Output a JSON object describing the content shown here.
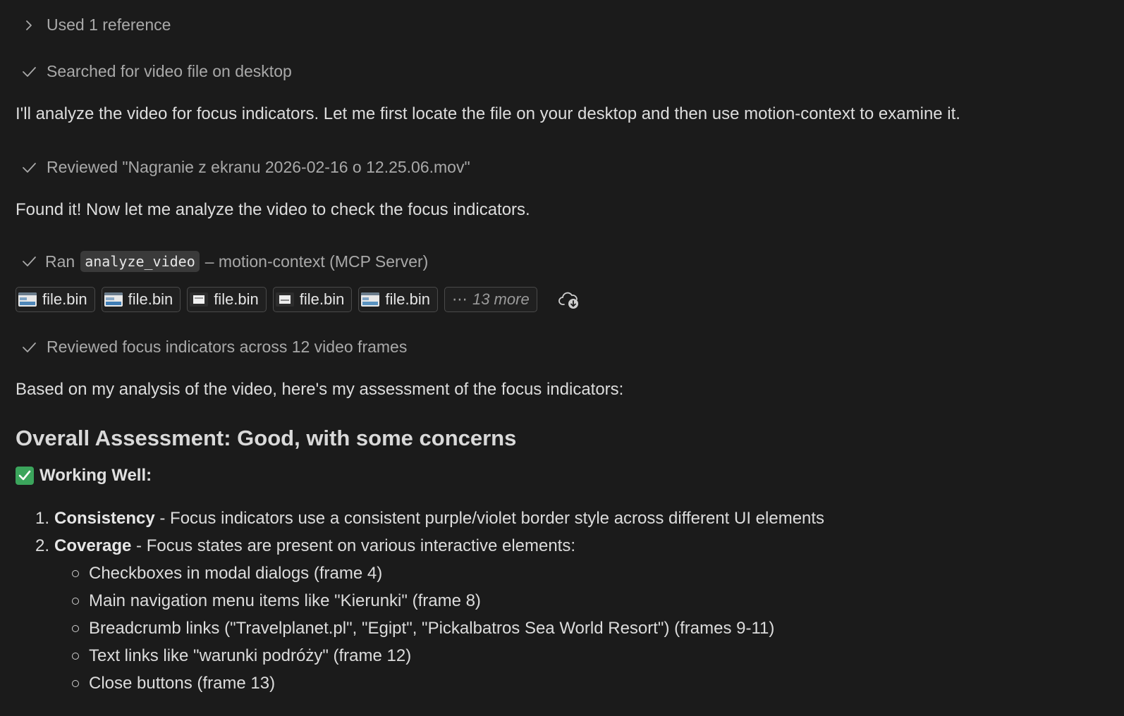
{
  "steps": {
    "references": "Used 1 reference",
    "searched": "Searched for video file on desktop",
    "reviewed_file": "Reviewed \"Nagranie z ekranu 2026-02-16 o 12.25.06.mov\"",
    "ran_prefix": "Ran",
    "ran_code": "analyze_video",
    "ran_suffix": "– motion-context (MCP Server)",
    "reviewed_frames": "Reviewed focus indicators across 12 video frames"
  },
  "messages": {
    "intro": "I'll analyze the video for focus indicators. Let me first locate the file on your desktop and then use motion-context to examine it.",
    "found": "Found it! Now let me analyze the video to check the focus indicators.",
    "based_on": "Based on my analysis of the video, here's my assessment of the focus indicators:"
  },
  "attachments": {
    "files": [
      "file.bin",
      "file.bin",
      "file.bin",
      "file.bin",
      "file.bin"
    ],
    "more_label": "13 more"
  },
  "assessment": {
    "title": "Overall Assessment: Good, with some concerns",
    "working_well_label": "Working Well:",
    "items": [
      {
        "number": "1.",
        "term": "Consistency",
        "text": " - Focus indicators use a consistent purple/violet border style across different UI elements"
      },
      {
        "number": "2.",
        "term": "Coverage",
        "text": " - Focus states are present on various interactive elements:"
      }
    ],
    "coverage_list": [
      "Checkboxes in modal dialogs (frame 4)",
      "Main navigation menu items like \"Kierunki\" (frame 8)",
      "Breadcrumb links (\"Travelplanet.pl\", \"Egipt\", \"Pickalbatros Sea World Resort\") (frames 9-11)",
      "Text links like \"warunki podróży\" (frame 12)",
      "Close buttons (frame 13)"
    ]
  },
  "colors": {
    "background": "#1b1b1b",
    "muted_text": "#a9a9a9",
    "body_text": "#dddddd",
    "check_emoji": "#3ba55c"
  }
}
